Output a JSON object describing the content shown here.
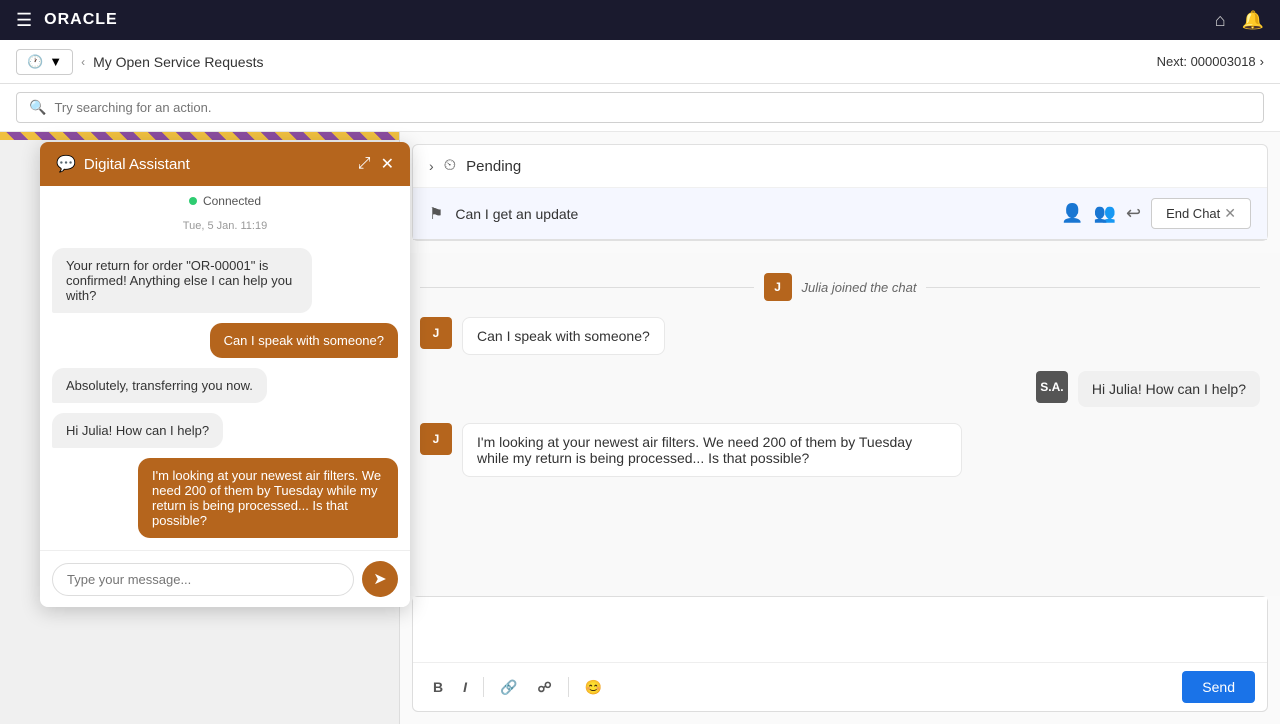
{
  "topNav": {
    "logo": "ORACLE",
    "hamburger": "≡"
  },
  "subNav": {
    "title": "My Open Service Requests",
    "leftArrow": "‹",
    "nextLabel": "Next: 000003018",
    "nextArrow": "›"
  },
  "search": {
    "placeholder": "Try searching for an action."
  },
  "digitalAssistant": {
    "title": "Digital Assistant",
    "status": "Connected",
    "timestamp": "Tue, 5 Jan. 11:19",
    "messages": [
      {
        "type": "bot",
        "text": "Your return for order \"OR-00001\" is confirmed! Anything else I can help you with?"
      },
      {
        "type": "user",
        "text": "Can I speak with someone?"
      },
      {
        "type": "bot",
        "text": "Absolutely, transferring you now."
      },
      {
        "type": "bot",
        "text": "Hi Julia! How can I help?"
      },
      {
        "type": "user",
        "text": "I'm looking at your newest air filters. We need 200 of them by Tuesday while my return is being processed... Is that possible?"
      }
    ],
    "inputPlaceholder": "Type your message...",
    "minimizeIcon": "⤢",
    "closeIcon": "✕"
  },
  "pending": {
    "title": "Pending"
  },
  "chatHeader": {
    "updateText": "Can I get an update",
    "endChatLabel": "End Chat"
  },
  "chatMessages": [
    {
      "type": "join",
      "text": "Julia joined the chat",
      "avatarLabel": "J"
    },
    {
      "type": "customer",
      "text": "Can I speak with someone?",
      "avatarLabel": "J"
    },
    {
      "type": "agent",
      "text": "Hi Julia! How can I help?",
      "avatarLabel": "S.A."
    },
    {
      "type": "customer",
      "text": "I'm looking at your newest air filters. We need 200 of them by Tuesday while my return is being processed... Is that possible?",
      "avatarLabel": "J"
    }
  ],
  "chatToolbar": {
    "boldLabel": "B",
    "italicLabel": "I",
    "linkLabel": "🔗",
    "unlinkLabel": "⛓",
    "emojiLabel": "😊",
    "sendLabel": "Send"
  }
}
